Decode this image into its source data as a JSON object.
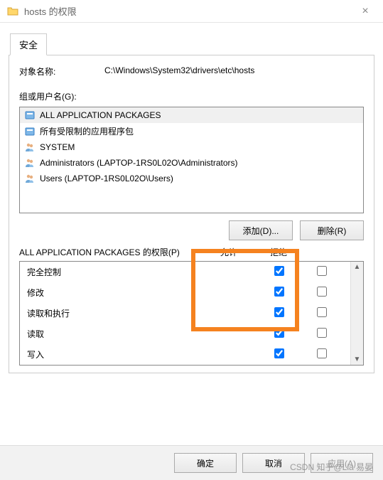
{
  "window": {
    "title": "hosts 的权限",
    "close_glyph": "×"
  },
  "tab": {
    "security": "安全"
  },
  "object": {
    "label": "对象名称:",
    "path": "C:\\Windows\\System32\\drivers\\etc\\hosts"
  },
  "groupbox_label": "组或用户名(G):",
  "users": [
    {
      "name": "ALL APPLICATION PACKAGES",
      "icon": "package"
    },
    {
      "name": "所有受限制的应用程序包",
      "icon": "package"
    },
    {
      "name": "SYSTEM",
      "icon": "users"
    },
    {
      "name": "Administrators (LAPTOP-1RS0L02O\\Administrators)",
      "icon": "users"
    },
    {
      "name": "Users (LAPTOP-1RS0L02O\\Users)",
      "icon": "users"
    }
  ],
  "buttons": {
    "add": "添加(D)...",
    "remove": "删除(R)"
  },
  "perm_header": {
    "name": "ALL APPLICATION PACKAGES 的权限(P)",
    "allow": "允许",
    "deny": "拒绝"
  },
  "permissions": [
    {
      "name": "完全控制",
      "allow": true,
      "deny": false
    },
    {
      "name": "修改",
      "allow": true,
      "deny": false
    },
    {
      "name": "读取和执行",
      "allow": true,
      "deny": false
    },
    {
      "name": "读取",
      "allow": true,
      "deny": false
    },
    {
      "name": "写入",
      "allow": true,
      "deny": false
    }
  ],
  "footer": {
    "ok": "确定",
    "cancel": "取消",
    "apply": "应用(A)"
  },
  "watermark": "CSDN 知乎@Lia 易晏"
}
